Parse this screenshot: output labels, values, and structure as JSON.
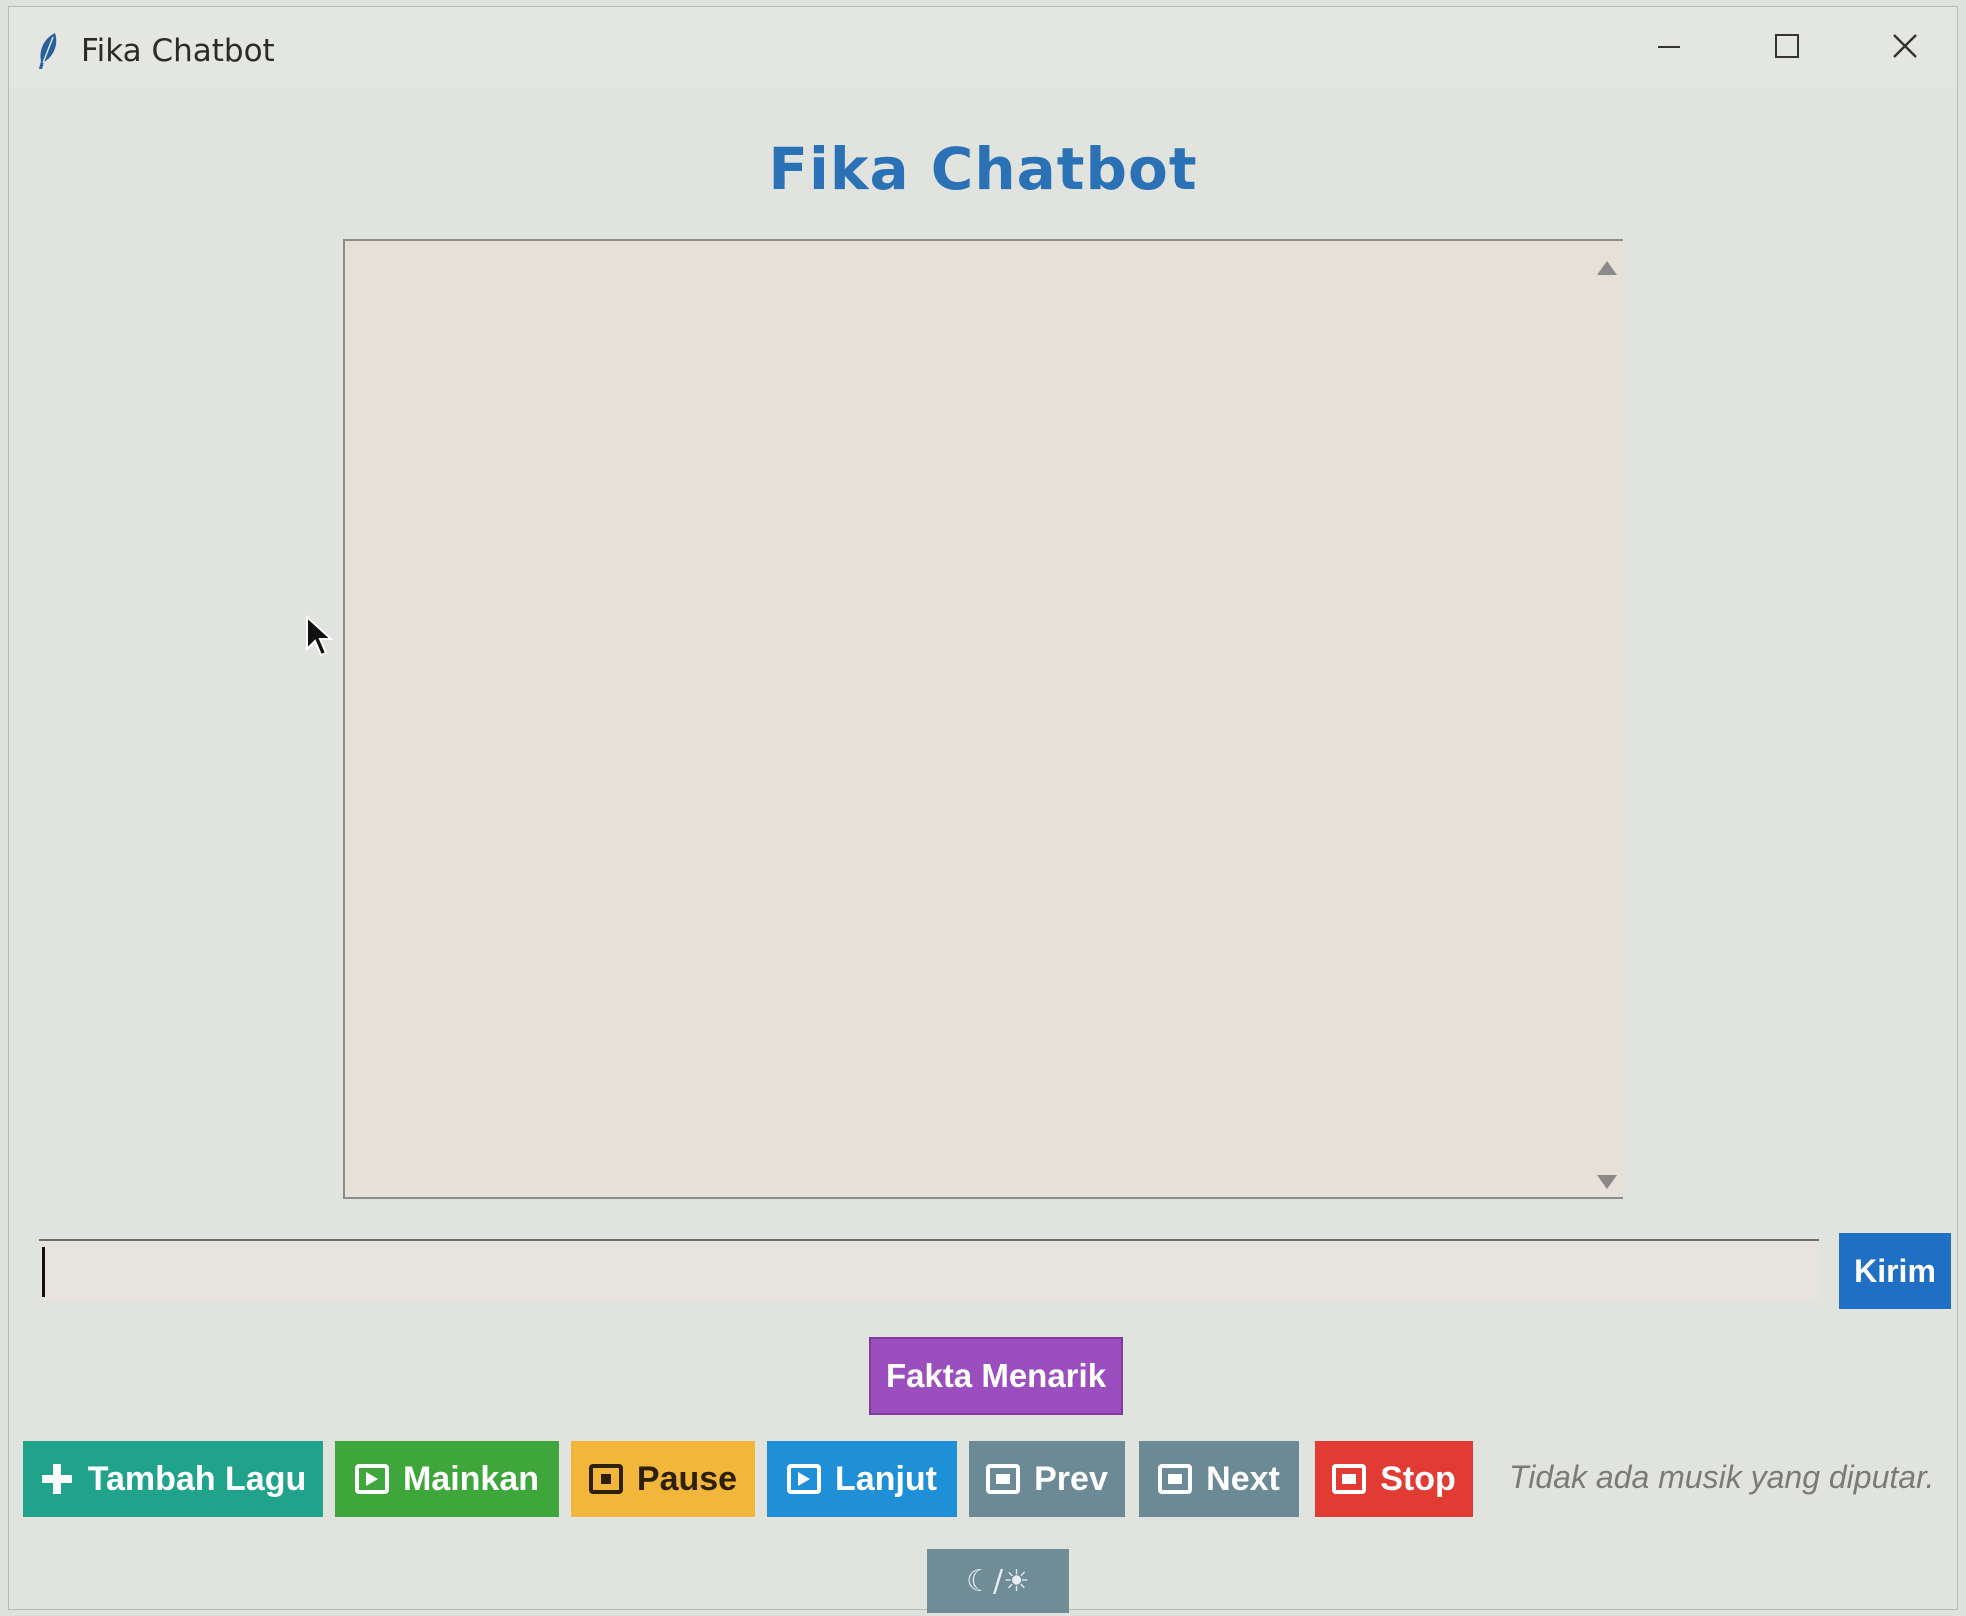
{
  "window": {
    "title": "Fika Chatbot"
  },
  "header": {
    "title": "Fika Chatbot"
  },
  "chat": {
    "messages": []
  },
  "input": {
    "value": "",
    "send_label": "Kirim"
  },
  "fact_button": "Fakta Menarik",
  "music_controls": {
    "add_song": "Tambah Lagu",
    "play": "Mainkan",
    "pause": "Pause",
    "resume": "Lanjut",
    "prev": "Prev",
    "next": "Next",
    "stop": "Stop",
    "status": "Tidak ada musik yang diputar."
  },
  "theme_toggle": "☾/☀",
  "colors": {
    "title_blue": "#2a72b5",
    "send_blue": "#1f6fc4",
    "fact_purple": "#9b4fbf",
    "add_teal": "#20a38a",
    "play_green": "#3ea63a",
    "pause_yellow": "#f2b63a",
    "resume_blue": "#1f8fd7",
    "nav_gray": "#6c8a95",
    "stop_red": "#e13b33"
  }
}
